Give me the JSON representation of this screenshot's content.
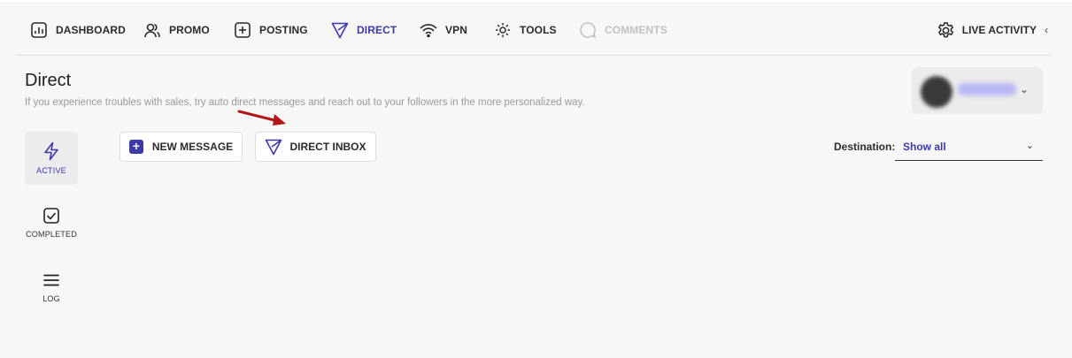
{
  "nav": {
    "items": [
      {
        "label": "DASHBOARD",
        "icon": "dashboard-icon",
        "state": "normal"
      },
      {
        "label": "PROMO",
        "icon": "users-icon",
        "state": "normal"
      },
      {
        "label": "POSTING",
        "icon": "plus-square-icon",
        "state": "normal"
      },
      {
        "label": "DIRECT",
        "icon": "send-icon",
        "state": "active"
      },
      {
        "label": "VPN",
        "icon": "wifi-icon",
        "state": "normal"
      },
      {
        "label": "TOOLS",
        "icon": "tools-icon",
        "state": "normal"
      },
      {
        "label": "COMMENTS",
        "icon": "comment-icon",
        "state": "disabled"
      }
    ],
    "live_activity": {
      "label": "LIVE ACTIVITY",
      "chevron": "‹"
    }
  },
  "header": {
    "title": "Direct",
    "subtitle": "If you experience troubles with sales, try auto direct messages and reach out to your followers in the more personalized way.",
    "account_name": "xxxxxxxxx",
    "account_chevron": "⌄"
  },
  "side_tabs": [
    {
      "label": "ACTIVE",
      "icon": "lightning-icon",
      "active": true
    },
    {
      "label": "COMPLETED",
      "icon": "checkbox-icon",
      "active": false
    },
    {
      "label": "LOG",
      "icon": "menu-icon",
      "active": false
    }
  ],
  "toolbar": {
    "new_message_label": "NEW MESSAGE",
    "new_message_icon": "+",
    "direct_inbox_label": "DIRECT INBOX"
  },
  "destination": {
    "label": "Destination:",
    "value": "Show all",
    "chevron": "⌄"
  },
  "colors": {
    "accent": "#3b3aa8",
    "background": "#f7f7f7",
    "annotation_arrow": "#b01818",
    "disabled": "#c2c2c2"
  }
}
